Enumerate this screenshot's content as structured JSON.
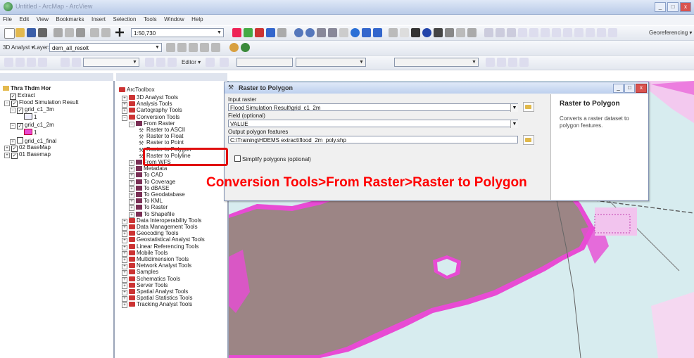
{
  "window": {
    "title": "Untitled - ArcMap - ArcView",
    "min": "_",
    "max": "□",
    "close": "x"
  },
  "menu": [
    "File",
    "Edit",
    "View",
    "Bookmarks",
    "Insert",
    "Selection",
    "Tools",
    "Window",
    "Help"
  ],
  "toolbar1": {
    "scale": "1:50,730",
    "georeferencing": "Georeferencing ▾"
  },
  "toolbar2": {
    "analyst": "3D Analyst ▾",
    "layer_label": "Layer:",
    "layer_value": "dem_all_resolt"
  },
  "toolbar3": {
    "editor": "Editor ▾"
  },
  "toc": {
    "items": [
      {
        "label": "Thra Thdm Hor",
        "level": 0,
        "bold": true
      },
      {
        "label": "Extract",
        "level": 1
      },
      {
        "label": "Flood Simulation Result",
        "level": 1
      },
      {
        "label": "grid_c1_3m",
        "level": 2
      },
      {
        "label": "1",
        "level": 3
      },
      {
        "label": "grid_c1_2m",
        "level": 2
      },
      {
        "label": "1",
        "level": 3
      },
      {
        "label": "grid_c1_final",
        "level": 2
      },
      {
        "label": "02 BaseMap",
        "level": 1
      },
      {
        "label": "01 Basemap",
        "level": 1
      }
    ]
  },
  "toolbox": {
    "root": "ArcToolbox",
    "items": [
      {
        "label": "3D Analyst Tools",
        "kind": "toolset",
        "level": 1
      },
      {
        "label": "Analysis Tools",
        "kind": "toolset",
        "level": 1
      },
      {
        "label": "Cartography Tools",
        "kind": "toolset",
        "level": 1
      },
      {
        "label": "Conversion Tools",
        "kind": "toolset",
        "level": 1
      },
      {
        "label": "From Raster",
        "kind": "sub",
        "level": 2
      },
      {
        "label": "Raster to ASCII",
        "kind": "tool",
        "level": 3
      },
      {
        "label": "Raster to Float",
        "kind": "tool",
        "level": 3
      },
      {
        "label": "Raster to Point",
        "kind": "tool",
        "level": 3
      },
      {
        "label": "Raster to Polygon",
        "kind": "tool",
        "level": 3
      },
      {
        "label": "Raster to Polyline",
        "kind": "tool",
        "level": 3
      },
      {
        "label": "From WFS",
        "kind": "sub",
        "level": 2
      },
      {
        "label": "Metadata",
        "kind": "sub",
        "level": 2
      },
      {
        "label": "To CAD",
        "kind": "sub",
        "level": 2
      },
      {
        "label": "To Coverage",
        "kind": "sub",
        "level": 2
      },
      {
        "label": "To dBASE",
        "kind": "sub",
        "level": 2
      },
      {
        "label": "To Geodatabase",
        "kind": "sub",
        "level": 2
      },
      {
        "label": "To KML",
        "kind": "sub",
        "level": 2
      },
      {
        "label": "To Raster",
        "kind": "sub",
        "level": 2
      },
      {
        "label": "To Shapefile",
        "kind": "sub",
        "level": 2
      },
      {
        "label": "Data Interoperability Tools",
        "kind": "toolset",
        "level": 1
      },
      {
        "label": "Data Management Tools",
        "kind": "toolset",
        "level": 1
      },
      {
        "label": "Geocoding Tools",
        "kind": "toolset",
        "level": 1
      },
      {
        "label": "Geostatistical Analyst Tools",
        "kind": "toolset",
        "level": 1
      },
      {
        "label": "Linear Referencing Tools",
        "kind": "toolset",
        "level": 1
      },
      {
        "label": "Mobile Tools",
        "kind": "toolset",
        "level": 1
      },
      {
        "label": "Multidimension Tools",
        "kind": "toolset",
        "level": 1
      },
      {
        "label": "Network Analyst Tools",
        "kind": "toolset",
        "level": 1
      },
      {
        "label": "Samples",
        "kind": "toolset",
        "level": 1
      },
      {
        "label": "Schematics Tools",
        "kind": "toolset",
        "level": 1
      },
      {
        "label": "Server Tools",
        "kind": "toolset",
        "level": 1
      },
      {
        "label": "Spatial Analyst Tools",
        "kind": "toolset",
        "level": 1
      },
      {
        "label": "Spatial Statistics Tools",
        "kind": "toolset",
        "level": 1
      },
      {
        "label": "Tracking Analyst Tools",
        "kind": "toolset",
        "level": 1
      }
    ]
  },
  "dialog": {
    "title": "Raster to Polygon",
    "input_raster_label": "Input raster",
    "input_raster_value": "Flood Simulation Result\\grid_c1_2m",
    "field_label": "Field (optional)",
    "field_value": "VALUE",
    "output_label": "Output polygon features",
    "output_value": "C:\\Training\\HDEMS extract\\flood_2m_poly.shp",
    "simplify_label": "Simplify polygons (optional)",
    "help_title": "Raster to Polygon",
    "help_text": "Converts a raster dataset to polygon features."
  },
  "annotation": "Conversion Tools>From Raster>Raster to Polygon",
  "colors": {
    "flood": "#9c8585",
    "flood_edge": "#e84bd4",
    "water": "#d6ecee",
    "highlight": "#e01010"
  }
}
